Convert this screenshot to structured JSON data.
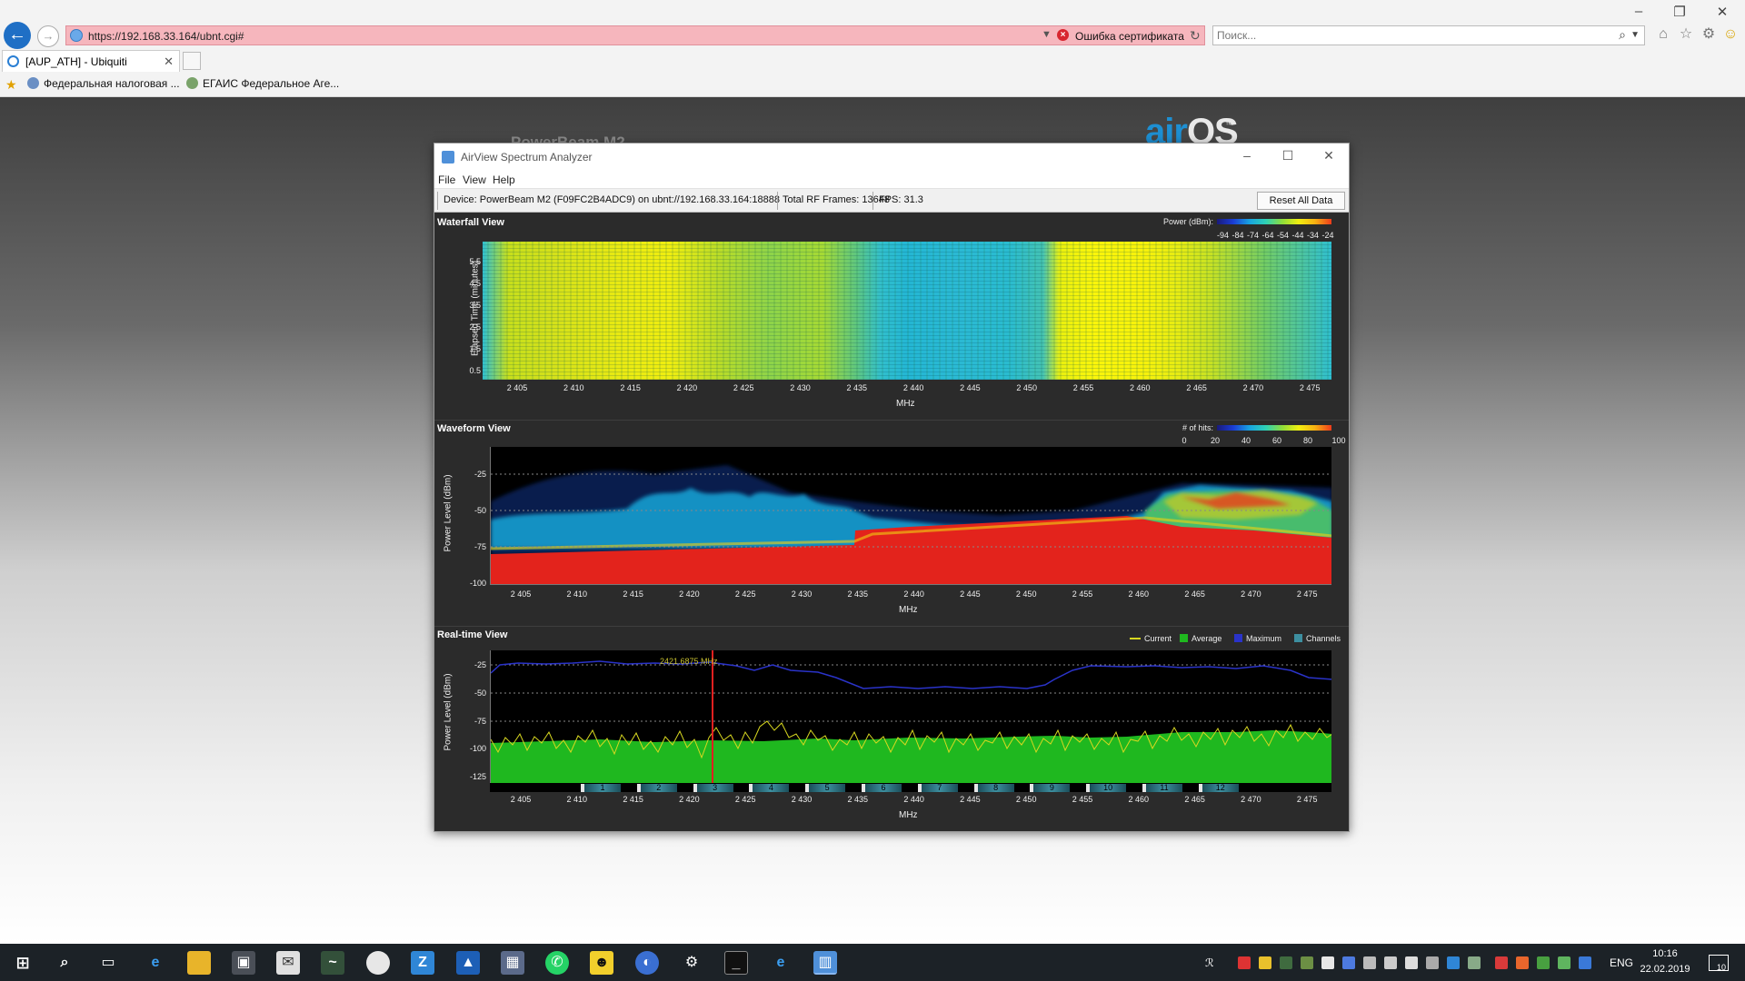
{
  "browser": {
    "window_controls": [
      "–",
      "❐",
      "✕"
    ],
    "url": "https://192.168.33.164/ubnt.cgi#",
    "cert_error": "Ошибка сертификата",
    "search_placeholder": "Поиск...",
    "tab_title": "[AUP_ATH] - Ubiquiti",
    "favorites": [
      "Федеральная налоговая ...",
      "ЕГАИС Федеральное Аге..."
    ]
  },
  "page": {
    "product_logo": "PowerBeam M2",
    "airos_logo_left": "air",
    "airos_logo_right": "OS",
    "airos_tm": "™"
  },
  "app": {
    "title": "AirView Spectrum Analyzer",
    "controls": [
      "–",
      "☐",
      "✕"
    ],
    "menu": [
      "File",
      "View",
      "Help"
    ],
    "status": {
      "device": "Device: PowerBeam M2 (F09FC2B4ADC9) on ubnt://192.168.33.164:18888",
      "frames": "Total RF Frames: 13648",
      "fps": "FPS: 31.3",
      "reset_label": "Reset All Data"
    },
    "waterfall": {
      "title": "Waterfall View",
      "legend_label": "Power (dBm):",
      "legend_ticks": [
        "-94",
        "-84",
        "-74",
        "-64",
        "-54",
        "-44",
        "-34",
        "-24"
      ],
      "ylabel": "Elapsed Time (minutes)",
      "yticks": [
        "5.5",
        "4.5",
        "3.5",
        "2.5",
        "1.5",
        "0.5"
      ],
      "xlabel": "MHz"
    },
    "waveform": {
      "title": "Waveform View",
      "legend_label": "# of hits:",
      "legend_ticks": [
        "0",
        "20",
        "40",
        "60",
        "80",
        "100"
      ],
      "ylabel": "Power Level (dBm)",
      "yticks": [
        "-25",
        "-50",
        "-75",
        "-100"
      ],
      "xlabel": "MHz"
    },
    "realtime": {
      "title": "Real-time View",
      "legend": [
        {
          "label": "Current",
          "color": "#d8d820"
        },
        {
          "label": "Average",
          "color": "#1fb81f"
        },
        {
          "label": "Maximum",
          "color": "#2a33c9"
        },
        {
          "label": "Channels",
          "color": "#3d8fa0"
        }
      ],
      "cursor_label": "2421.6875 MHz",
      "ylabel": "Power Level (dBm)",
      "yticks": [
        "-25",
        "-50",
        "-75",
        "-100",
        "-125"
      ],
      "channels": [
        "1",
        "2",
        "3",
        "4",
        "5",
        "6",
        "7",
        "8",
        "9",
        "10",
        "11",
        "12"
      ],
      "xlabel": "MHz"
    },
    "xticks": [
      "2 405",
      "2 410",
      "2 415",
      "2 420",
      "2 425",
      "2 430",
      "2 435",
      "2 440",
      "2 445",
      "2 450",
      "2 455",
      "2 460",
      "2 465",
      "2 470",
      "2 475"
    ]
  },
  "taskbar": {
    "lang": "ENG",
    "time": "10:16",
    "date": "22.02.2019",
    "notifications": "10"
  }
}
